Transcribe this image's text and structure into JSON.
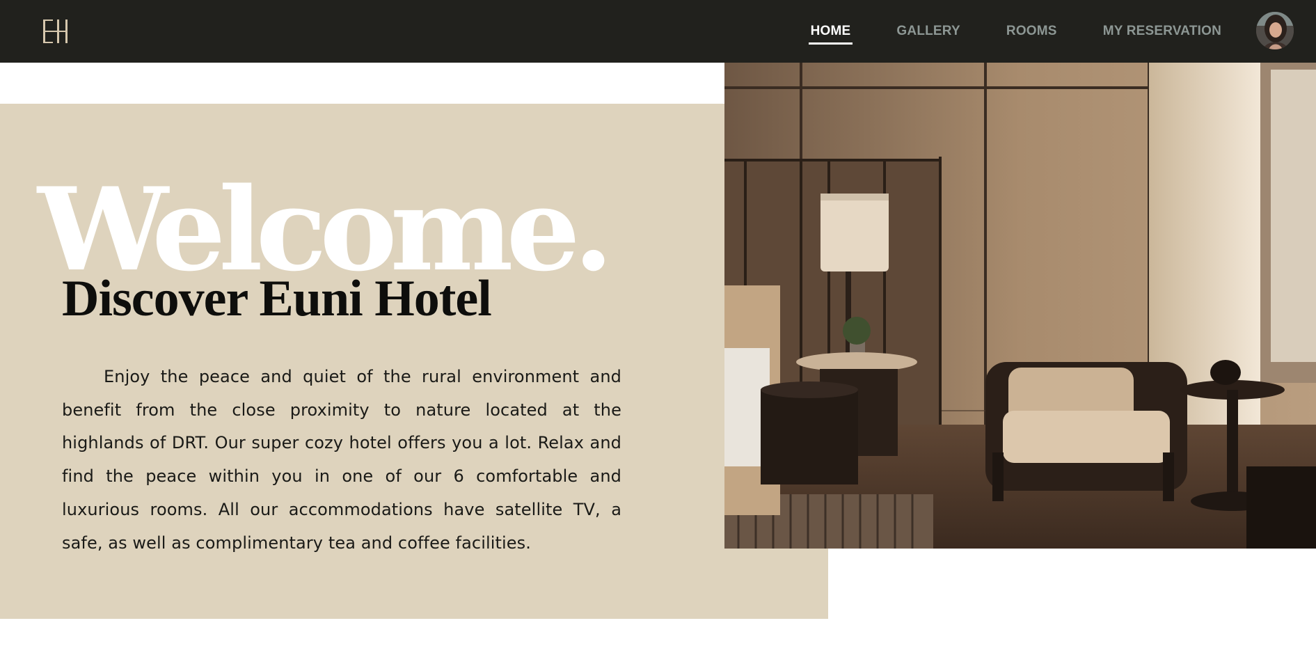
{
  "header": {
    "logo_text": "EH",
    "nav": [
      {
        "label": "HOME",
        "active": true
      },
      {
        "label": "GALLERY",
        "active": false
      },
      {
        "label": "ROOMS",
        "active": false
      },
      {
        "label": "MY RESERVATION",
        "active": false
      }
    ],
    "colors": {
      "bar": "#21211d",
      "nav_inactive": "#8d9794",
      "nav_active": "#ffffff",
      "logo": "#d6c7ad"
    }
  },
  "hero": {
    "welcome": "Welcome.",
    "title": "Discover Euni Hotel",
    "description": "Enjoy the peace and quiet of the rural environment and benefit from the close proximity to nature located at the highlands of DRT. Our super cozy hotel offers you a lot. Relax and find the peace within you in one of our 6 comfortable and luxurious rooms. All our accommodations have satellite TV, a safe, as well as complimentary tea and coffee facilities.",
    "colors": {
      "panel": "#ded3bd",
      "welcome": "#ffffff",
      "title": "#0e0e0c"
    }
  },
  "image": {
    "icon": "hotel-room-photo"
  },
  "user": {
    "icon": "user-avatar"
  }
}
